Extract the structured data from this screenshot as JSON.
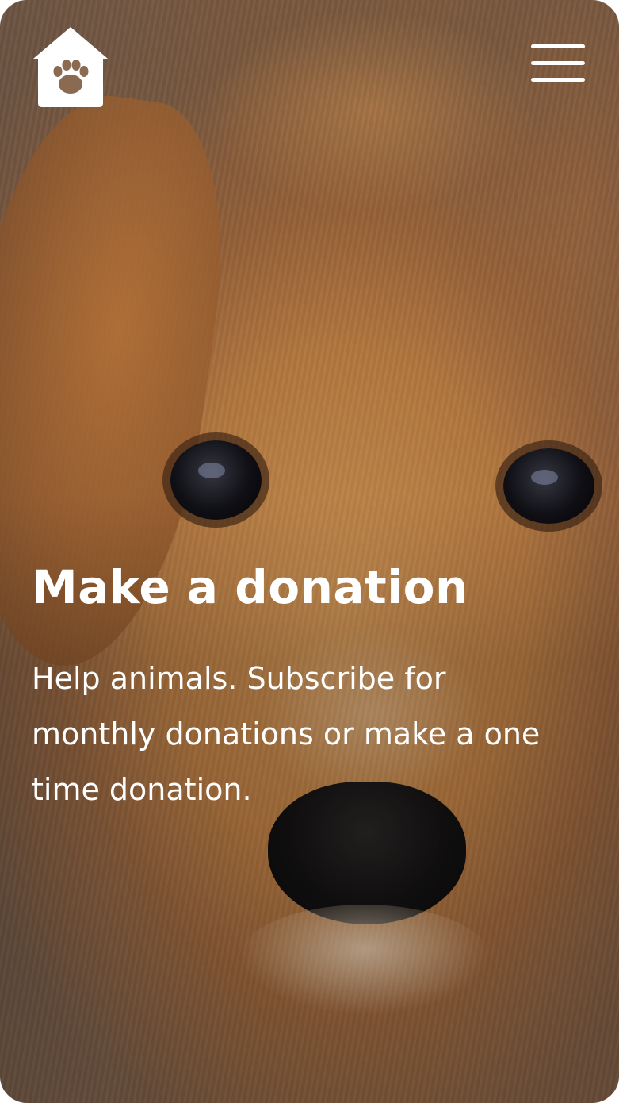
{
  "brand": {
    "logo_icon": "house-paw-icon"
  },
  "header": {
    "menu_icon": "hamburger-menu-icon"
  },
  "hero": {
    "title": "Make a donation",
    "description": "Help animals. Subscribe for monthly donations or make a one time donation.",
    "background_image": "close-up-dog-face-photo"
  },
  "colors": {
    "text": "#ffffff",
    "fur": "#c28a52"
  }
}
